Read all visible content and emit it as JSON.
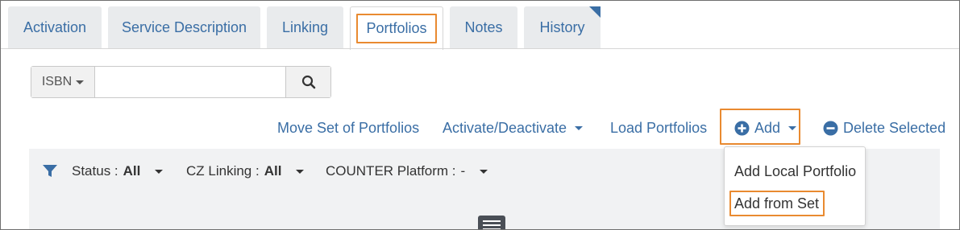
{
  "tabs": [
    {
      "label": "Activation"
    },
    {
      "label": "Service Description"
    },
    {
      "label": "Linking"
    },
    {
      "label": "Portfolios",
      "active": true
    },
    {
      "label": "Notes"
    },
    {
      "label": "History"
    }
  ],
  "search": {
    "type_label": "ISBN",
    "value": "",
    "placeholder": ""
  },
  "actions": {
    "move_set": "Move Set of Portfolios",
    "activate_deactivate": "Activate/Deactivate",
    "load_portfolios": "Load Portfolios",
    "add": "Add",
    "delete_selected": "Delete Selected"
  },
  "filters": {
    "status_label": "Status :",
    "status_value": "All",
    "cz_linking_label": "CZ Linking :",
    "cz_linking_value": "All",
    "counter_label": "COUNTER Platform :",
    "counter_value": "-"
  },
  "add_menu": {
    "items": [
      {
        "label": "Add Local Portfolio"
      },
      {
        "label": "Add from Set"
      }
    ]
  },
  "colors": {
    "link": "#3a6ea5",
    "highlight": "#e98a30",
    "tab_bg": "#e9ebed",
    "filter_bg": "#f1f2f3"
  }
}
